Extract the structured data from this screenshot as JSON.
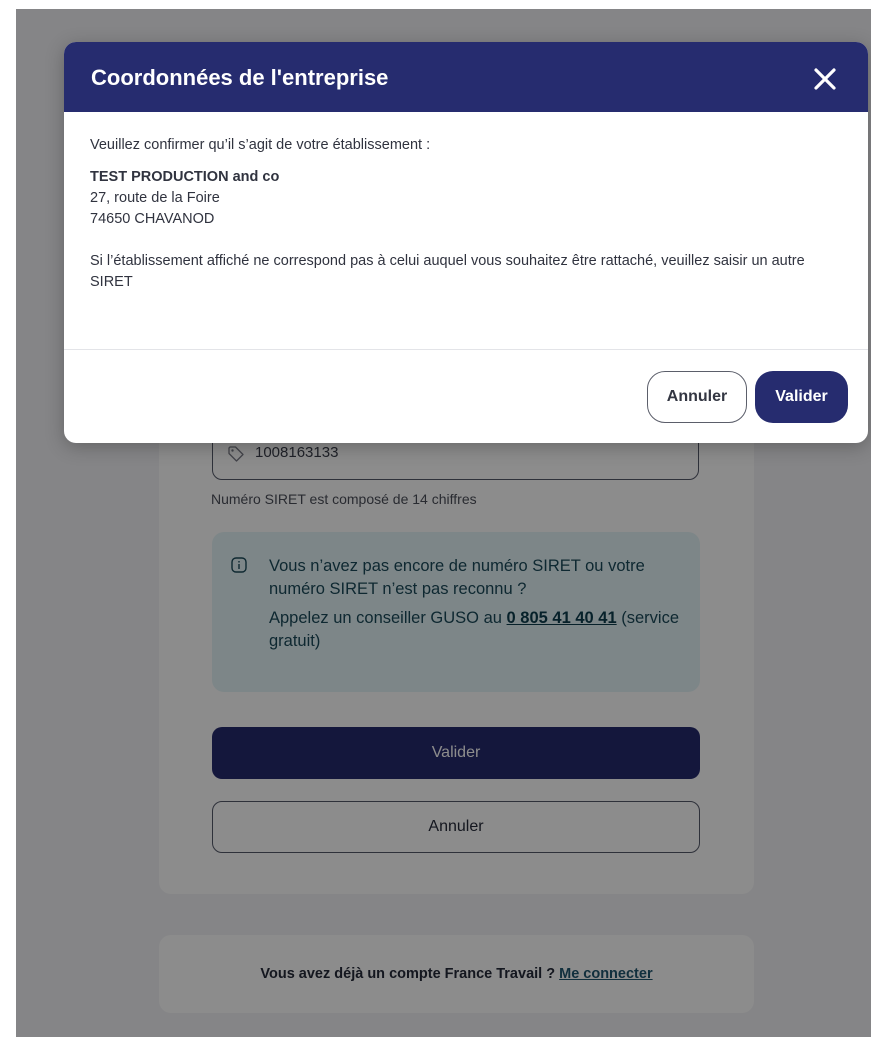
{
  "colors": {
    "brand": "#262c6f",
    "info_bg": "#e4f4f7",
    "overlay": "rgba(0,0,0,0.45)"
  },
  "background": {
    "siret_field": {
      "icon": "tag-icon",
      "value": "1008163133"
    },
    "siret_hint": "Numéro SIRET est composé de 14 chiffres",
    "info": {
      "icon": "info-icon",
      "line1": "Vous n’avez pas encore de numéro SIRET ou votre numéro SIRET n’est pas reconnu ?",
      "line2_prefix": "Appelez un conseiller GUSO au ",
      "phone": "0 805 41 40 41",
      "line2_suffix": " (service gratuit)"
    },
    "validate_label": "Valider",
    "cancel_label": "Annuler",
    "login": {
      "prompt": "Vous avez déjà un compte France Travail ? ",
      "link": "Me connecter"
    }
  },
  "modal": {
    "title": "Coordonnées de l'entreprise",
    "close_icon": "close-icon",
    "intro": "Veuillez confirmer qu’il s’agit de votre établissement :",
    "company_name": "TEST PRODUCTION and co",
    "address_line1": "27, route de la Foire",
    "address_line2": "74650 CHAVANOD",
    "notice": "Si l’établissement affiché ne correspond pas à celui auquel vous souhaitez être rattaché, veuillez saisir un autre SIRET",
    "cancel_label": "Annuler",
    "validate_label": "Valider"
  }
}
